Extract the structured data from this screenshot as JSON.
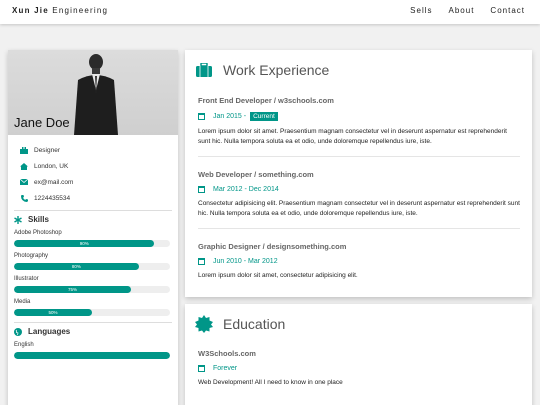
{
  "nav": {
    "brand_bold": "Xun Jie",
    "brand_rest": "Engineering",
    "links": [
      "Sells",
      "About",
      "Contact"
    ]
  },
  "profile": {
    "name": "Jane Doe",
    "job": "Designer",
    "location": "London, UK",
    "email": "ex@mail.com",
    "phone": "1224435534"
  },
  "skills": {
    "title": "Skills",
    "items": [
      {
        "name": "Adobe Photoshop",
        "level": "90%",
        "value": 90
      },
      {
        "name": "Photography",
        "level": "80%",
        "value": 80
      },
      {
        "name": "Illustrator",
        "level": "75%",
        "value": 75
      },
      {
        "name": "Media",
        "level": "50%",
        "value": 50
      }
    ]
  },
  "languages": {
    "title": "Languages",
    "items": [
      {
        "name": "English",
        "value": 100
      }
    ]
  },
  "work": {
    "title": "Work Experience",
    "entries": [
      {
        "title": "Front End Developer / w3schools.com",
        "date": "Jan 2015 -",
        "tag": "Current",
        "text": "Lorem ipsum dolor sit amet. Praesentium magnam consectetur vel in deserunt aspernatur est reprehenderit sunt hic. Nulla tempora soluta ea et odio, unde doloremque repellendus iure, iste."
      },
      {
        "title": "Web Developer / something.com",
        "date": "Mar 2012 - Dec 2014",
        "text": "Consectetur adipisicing elit. Praesentium magnam consectetur vel in deserunt aspernatur est reprehenderit sunt hic. Nulla tempora soluta ea et odio, unde doloremque repellendus iure, iste."
      },
      {
        "title": "Graphic Designer / designsomething.com",
        "date": "Jun 2010 - Mar 2012",
        "text": "Lorem ipsum dolor sit amet, consectetur adipisicing elit."
      }
    ]
  },
  "education": {
    "title": "Education",
    "entries": [
      {
        "title": "W3Schools.com",
        "date": "Forever",
        "text": "Web Development! All I need to know in one place"
      }
    ]
  },
  "colors": {
    "accent": "#009688"
  }
}
